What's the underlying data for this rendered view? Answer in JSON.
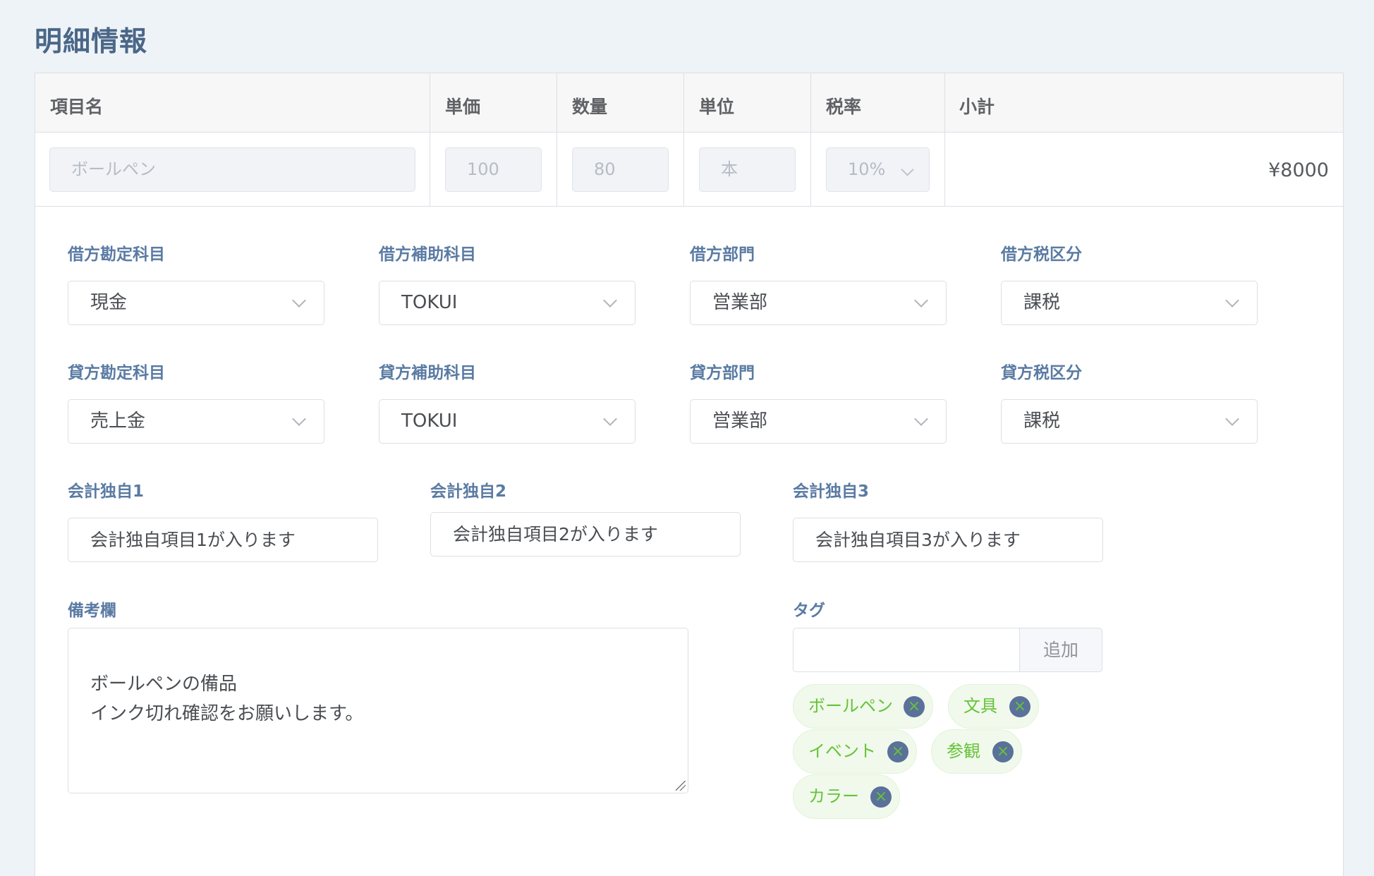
{
  "page": {
    "title": "明細情報"
  },
  "table": {
    "headers": {
      "item": "項目名",
      "price": "単価",
      "qty": "数量",
      "unit": "単位",
      "tax": "税率",
      "subtotal": "小計"
    },
    "row": {
      "item": "ボールペン",
      "price": "100",
      "qty": "80",
      "unit": "本",
      "tax": "10%",
      "subtotal": "¥8000"
    }
  },
  "debit": {
    "account_label": "借方勘定科目",
    "account": "現金",
    "sub_label": "借方補助科目",
    "sub": "TOKUI",
    "dept_label": "借方部門",
    "dept": "営業部",
    "tax_label": "借方税区分",
    "tax": "課税"
  },
  "credit": {
    "account_label": "貸方勘定科目",
    "account": "売上金",
    "sub_label": "貸方補助科目",
    "sub": "TOKUI",
    "dept_label": "貸方部門",
    "dept": "営業部",
    "tax_label": "貸方税区分",
    "tax": "課税"
  },
  "custom": {
    "c1_label": "会計独自1",
    "c1": "会計独自項目1が入ります",
    "c2_label": "会計独自2",
    "c2": "会計独自項目2が入ります",
    "c3_label": "会計独自3",
    "c3": "会計独自項目3が入ります"
  },
  "remarks": {
    "label": "備考欄",
    "value": "ボールペンの備品\nインク切れ確認をお願いします。"
  },
  "tags": {
    "label": "タグ",
    "add_label": "追加",
    "items": [
      "ボールペン",
      "文具",
      "イベント",
      "参観",
      "カラー"
    ],
    "close_glyph": "×"
  }
}
